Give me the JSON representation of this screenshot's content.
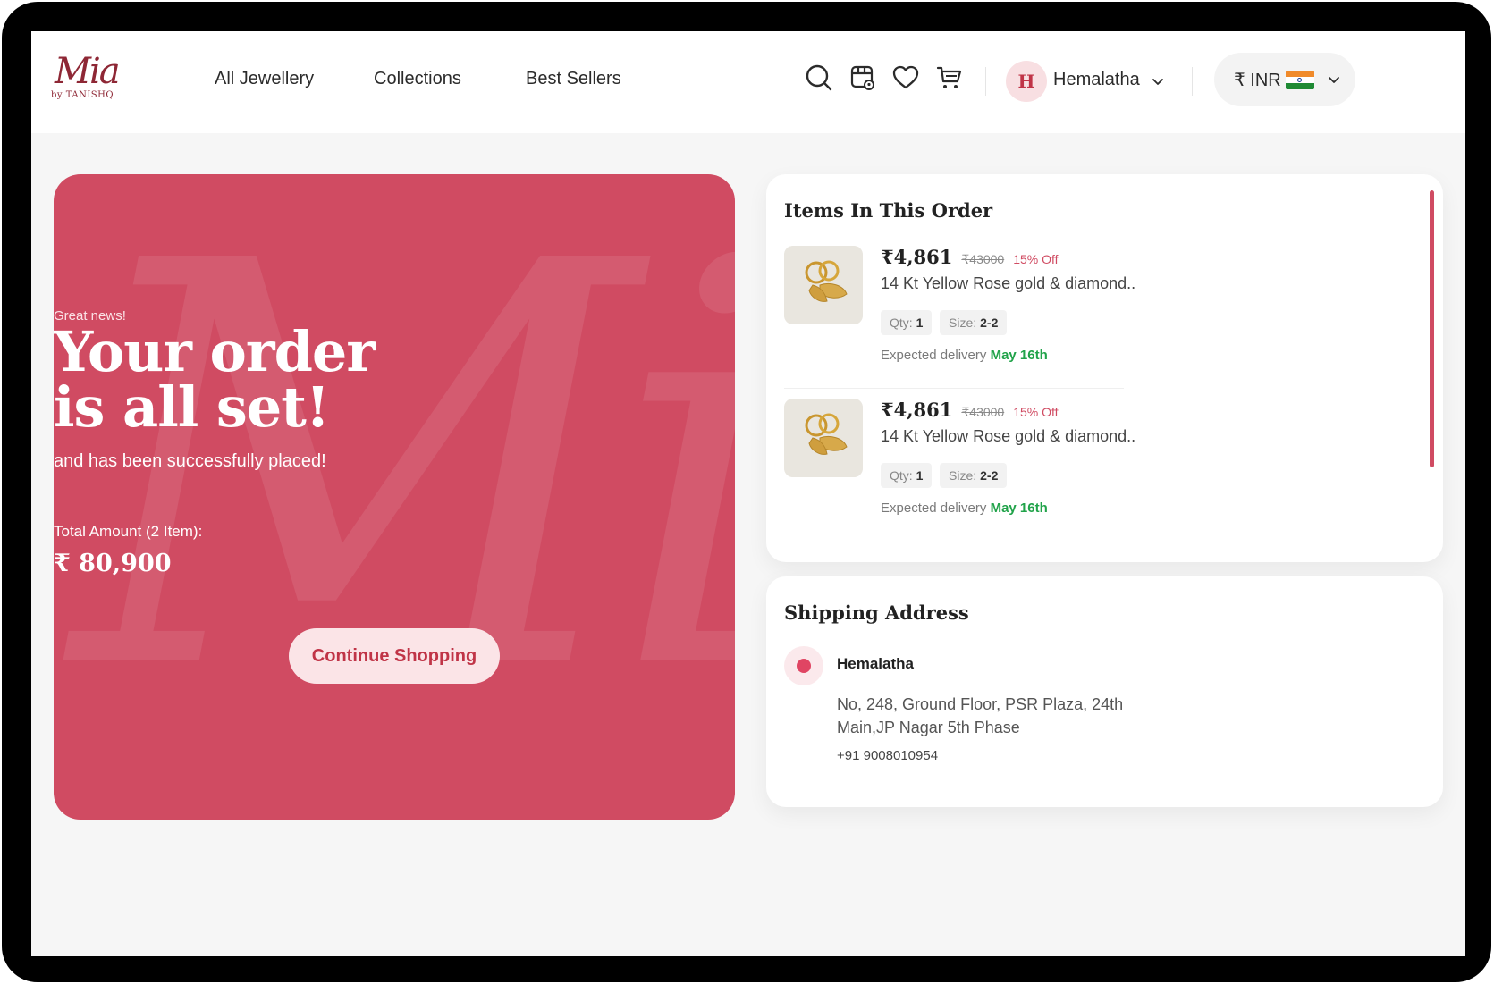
{
  "brand": {
    "logo_main": "Mia",
    "logo_sub": "by TANISHQ",
    "accent": "#d04b62"
  },
  "nav": {
    "items": [
      "All Jewellery",
      "Collections",
      "Best Sellers"
    ]
  },
  "header_icons": [
    "search-icon",
    "store-icon",
    "wishlist-heart-icon",
    "cart-icon"
  ],
  "user": {
    "initial": "H",
    "name": "Hemalatha"
  },
  "currency": {
    "label": "₹ INR",
    "flag": "india-flag-icon"
  },
  "hero": {
    "eyebrow": "Great news!",
    "headline_line1": "Your order",
    "headline_line2": "is all set!",
    "subline": "and has been successfully placed!",
    "total_label": "Total Amount (2 Item):",
    "total_amount": "₹ 80,900",
    "cta_label": "Continue Shopping",
    "watermark": "Mia"
  },
  "order": {
    "title": "Items In This Order",
    "items": [
      {
        "price": "₹4,861",
        "mrp": "₹43000",
        "discount": "15% Off",
        "name": "14 Kt Yellow Rose gold & diamond..",
        "qty_label": "Qty:",
        "qty": "1",
        "size_label": "Size:",
        "size": "2-2",
        "delivery_label": "Expected delivery",
        "delivery_date": "May 16th"
      },
      {
        "price": "₹4,861",
        "mrp": "₹43000",
        "discount": "15% Off",
        "name": "14 Kt Yellow Rose gold & diamond..",
        "qty_label": "Qty:",
        "qty": "1",
        "size_label": "Size:",
        "size": "2-2",
        "delivery_label": "Expected delivery",
        "delivery_date": "May 16th"
      }
    ]
  },
  "shipping": {
    "title": "Shipping Address",
    "name": "Hemalatha",
    "address": "No, 248, Ground Floor, PSR Plaza, 24th Main,JP Nagar 5th Phase",
    "phone": "+91 9008010954"
  }
}
